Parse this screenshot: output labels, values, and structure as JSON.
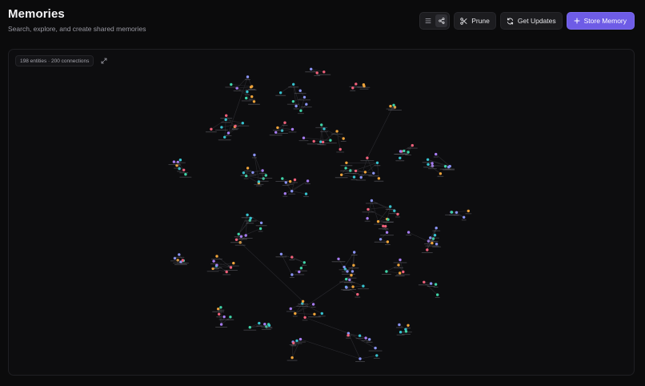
{
  "header": {
    "title": "Memories",
    "subtitle": "Search, explore, and create shared memories"
  },
  "toolbar": {
    "prune_label": "Prune",
    "updates_label": "Get Updates",
    "store_label": "Store Memory",
    "active_view": "graph"
  },
  "graph": {
    "stats_label": "198 entities · 200 connections",
    "entity_count": 198,
    "connection_count": 200,
    "node_colors": {
      "blue": "#8a93f5",
      "green": "#3fd3a7",
      "orange": "#f0a43a",
      "pink": "#f0607a",
      "purple": "#a77cf2",
      "teal": "#36c2cf"
    },
    "edge_color": "#2b2b30",
    "label_color": "#6c6c74"
  },
  "colors": {
    "background": "#0b0b0c",
    "panel": "#0d0d0f",
    "accent": "#6e5ce6",
    "text_primary": "#f4f4f6",
    "text_secondary": "#9a9aa3"
  }
}
